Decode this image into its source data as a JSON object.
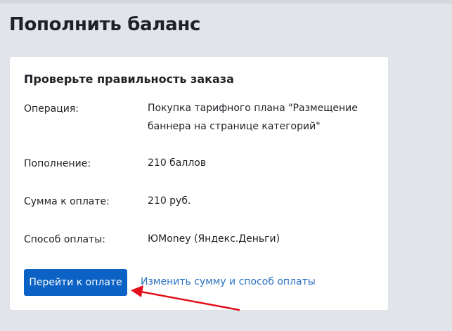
{
  "page": {
    "title": "Пополнить баланс"
  },
  "order": {
    "card_title": "Проверьте правильность заказа",
    "rows": [
      {
        "label": "Операция:",
        "value_lines": [
          "Покупка тарифного плана \"Размещение",
          "баннера на странице категорий\""
        ]
      },
      {
        "label": "Пополнение:",
        "value": "210 баллов"
      },
      {
        "label": "Сумма к оплате:",
        "value": "210 руб."
      },
      {
        "label": "Способ оплаты:",
        "value": "ЮMoney (Яндекс.Деньги)"
      }
    ],
    "pay_button_label": "Перейти к оплате",
    "change_link_label": "Изменить сумму и способ оплаты"
  },
  "annotation": {
    "arrow_color": "#e3101b"
  },
  "colors": {
    "background": "#e1e4e9",
    "primary_button": "#0b62c4",
    "link": "#2a72c4"
  }
}
